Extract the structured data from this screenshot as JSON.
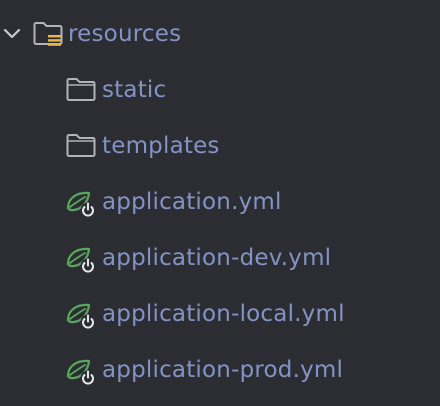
{
  "colors": {
    "background": "#2b2d33",
    "label": "#8493c3",
    "folder_icon": "#b1b4bb",
    "resources_badge": "#e8b94a",
    "spring_icon": "#58a85c",
    "chevron": "#c8cad0"
  },
  "tree": {
    "root": {
      "label": "resources",
      "icon": "resources-folder-icon",
      "expanded": true
    },
    "children": [
      {
        "label": "static",
        "icon": "folder-icon"
      },
      {
        "label": "templates",
        "icon": "folder-icon"
      },
      {
        "label": "application.yml",
        "icon": "spring-config-icon"
      },
      {
        "label": "application-dev.yml",
        "icon": "spring-config-icon"
      },
      {
        "label": "application-local.yml",
        "icon": "spring-config-icon"
      },
      {
        "label": "application-prod.yml",
        "icon": "spring-config-icon"
      }
    ]
  }
}
